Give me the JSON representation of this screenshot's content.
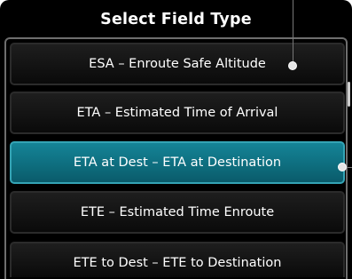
{
  "dialog": {
    "title": "Select Field Type"
  },
  "field_types": [
    {
      "label": "ESA – Enroute Safe Altitude",
      "selected": false
    },
    {
      "label": "ETA – Estimated Time of Arrival",
      "selected": false
    },
    {
      "label": "ETA at Dest – ETA at Destination",
      "selected": true
    },
    {
      "label": "ETE – Estimated Time Enroute",
      "selected": false
    },
    {
      "label": "ETE to Dest – ETE to Destination",
      "selected": false
    }
  ],
  "colors": {
    "background": "#000000",
    "selected_fill": "#0e6e7f",
    "text": "#ffffff"
  }
}
